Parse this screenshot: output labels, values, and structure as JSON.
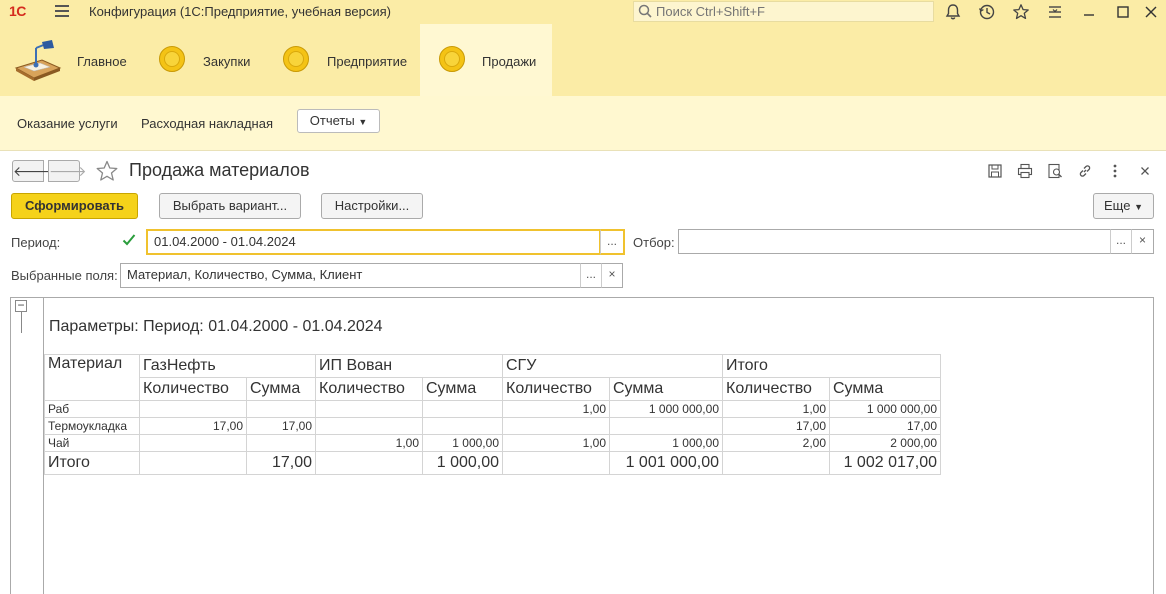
{
  "app": {
    "logo": "1С",
    "title": "Конфигурация  (1С:Предприятие, учебная версия)",
    "search_placeholder": "Поиск Ctrl+Shift+F"
  },
  "sections": [
    "Главное",
    "Закупки",
    "Предприятие",
    "Продажи"
  ],
  "active_section": "Продажи",
  "commands": {
    "service": "Оказание услуги",
    "invoice": "Расходная накладная",
    "reports": "Отчеты"
  },
  "form": {
    "title": "Продажа материалов",
    "generate": "Сформировать",
    "choose_variant": "Выбрать вариант...",
    "settings": "Настройки...",
    "more": "Еще",
    "period_label": "Период:",
    "period_value": "01.04.2000 - 01.04.2024",
    "filter_label": "Отбор:",
    "filter_value": "",
    "fields_label": "Выбранные поля:",
    "fields_value": "Материал, Количество, Сумма, Клиент",
    "ellipsis": "...",
    "clear": "×"
  },
  "report": {
    "params": "Параметры:    Период: 01.04.2000 - 01.04.2024",
    "row_header": "Материал",
    "groups": [
      "ГазНефть",
      "ИП Вован",
      "СГУ",
      "Итого"
    ],
    "subheaders": [
      "Количество",
      "Сумма"
    ],
    "rows": [
      {
        "name": "Раб",
        "cells": [
          "",
          "",
          "",
          "",
          "1,00",
          "1 000 000,00",
          "1,00",
          "1 000 000,00"
        ]
      },
      {
        "name": "Термоукладка",
        "cells": [
          "17,00",
          "17,00",
          "",
          "",
          "",
          "",
          "17,00",
          "17,00"
        ]
      },
      {
        "name": "Чай",
        "cells": [
          "",
          "",
          "1,00",
          "1 000,00",
          "1,00",
          "1 000,00",
          "2,00",
          "2 000,00"
        ]
      }
    ],
    "total": {
      "name": "Итого",
      "cells": [
        "",
        "17,00",
        "",
        "1 000,00",
        "",
        "1 001 000,00",
        "",
        "1 002 017,00"
      ]
    }
  }
}
